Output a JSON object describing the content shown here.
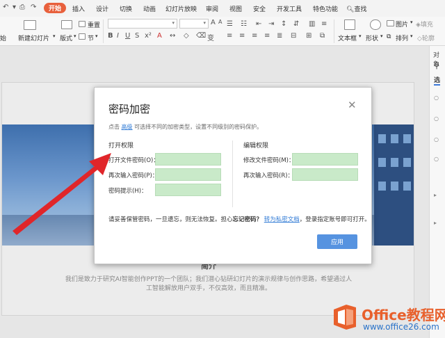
{
  "ribbon_tabs": {
    "home": "开始",
    "insert": "插入",
    "design": "设计",
    "transitions": "切换",
    "animations": "动画",
    "slideshow": "幻灯片放映",
    "review": "审阅",
    "view": "视图",
    "security": "安全",
    "developer": "开发工具",
    "special": "特色功能",
    "search": "查找"
  },
  "ribbon": {
    "new_slide": "新建幻灯片",
    "layout": "版式",
    "section": "节",
    "reset": "重置",
    "textbox": "文本框",
    "shape": "形状",
    "picture": "图片",
    "fill": "填充",
    "arrange": "排列",
    "left_stub": "始",
    "right_stub": "轮廓"
  },
  "taskpane": {
    "label_top": "对象",
    "label_mid": "选"
  },
  "slide": {
    "heading": "简介",
    "body_line1": "我们是致力于研究AI智能创作PPT的一个团队；我们潜心钻研幻灯片的演示规律与创作思路，希望通过人",
    "body_line2": "工智能解放用户双手，不仅高效，而且精准。"
  },
  "dialog": {
    "title": "密码加密",
    "desc_prefix": "点击",
    "desc_link": "高级",
    "desc_suffix": "可选择不同的加密类型，设置不同级别的密码保护。",
    "open_group": "打开权限",
    "edit_group": "编辑权限",
    "open_password_label": "打开文件密码(O)：",
    "open_confirm_label": "再次输入密码(P)：",
    "hint_label": "密码提示(H)：",
    "modify_password_label": "修改文件密码(M)：",
    "modify_confirm_label": "再次输入密码(R)：",
    "note_prefix": "请妥善保管密码，一旦遗忘，则无法恢复。担心",
    "note_bold": "忘记密码？",
    "note_link": "转为私密文档",
    "note_suffix": "，登录指定账号即可打开。",
    "apply_button": "应用"
  },
  "watermark": {
    "brand": "Office教程网",
    "url": "www.office26.com"
  },
  "colors": {
    "accent_tab": "#e8603c",
    "input_fill": "#c9eac9",
    "apply_button": "#5693e0",
    "arrow": "#e0262a",
    "link": "#2f7ad5"
  }
}
